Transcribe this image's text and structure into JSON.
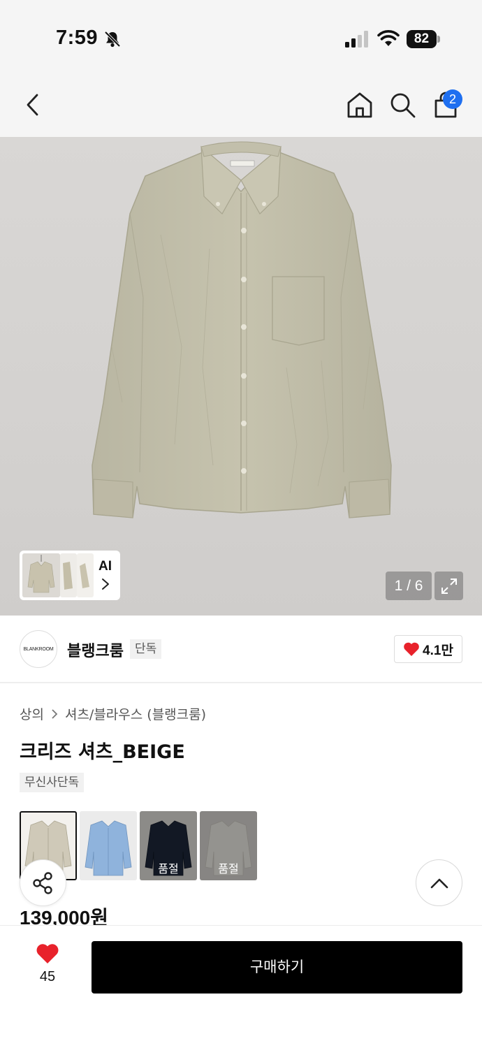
{
  "status_bar": {
    "time": "7:59",
    "battery": "82"
  },
  "header": {
    "cart_badge": "2"
  },
  "gallery": {
    "ai_label": "AI",
    "counter": "1 / 6"
  },
  "brand": {
    "logo_text": "BLANKROOM",
    "name": "블랭크룸",
    "tag": "단독",
    "likes": "4.1만"
  },
  "breadcrumb": [
    "상의",
    "셔츠/블라우스 (블랭크룸)"
  ],
  "product": {
    "title": "크리즈 셔츠_BEIGE",
    "exclusive_tag": "무신사단독",
    "price": "139,000원"
  },
  "colors": [
    {
      "color": "#cfc9b8",
      "selected": true,
      "label": ""
    },
    {
      "color": "#8fb3dc",
      "selected": false,
      "label": ""
    },
    {
      "color": "#1c2538",
      "selected": false,
      "label": "품절"
    },
    {
      "color": "#e4e2dc",
      "selected": false,
      "label": "품절"
    }
  ],
  "bottom_bar": {
    "wish_count": "45",
    "buy_label": "구매하기"
  },
  "theme": {
    "accent_red": "#e8222b",
    "badge_blue": "#1e6ff0"
  }
}
